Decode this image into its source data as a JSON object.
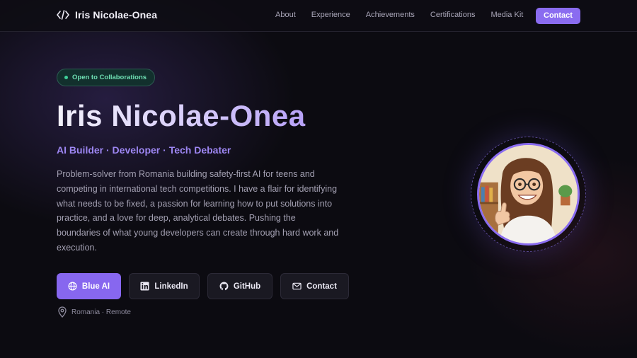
{
  "nav": {
    "brand_name": "Iris Nicolae-Onea",
    "brand_icon": "code-icon",
    "links": [
      "About",
      "Experience",
      "Achievements",
      "Certifications",
      "Media Kit"
    ],
    "contact_label": "Contact"
  },
  "hero": {
    "badge": "Open to Collaborations",
    "title": "Iris Nicolae-Onea",
    "subtitle": "AI Builder · Developer · Tech Debater",
    "description": "Problem-solver from Romania building safety-first AI for teens and competing in international tech competitions. I have a flair for identifying what needs to be fixed, a passion for learning how to put solutions into practice, and a love for deep, analytical debates. Pushing the boundaries of what young developers can create through hard work and execution.",
    "buttons": [
      {
        "label": "Blue AI",
        "icon": "globe-icon"
      },
      {
        "label": "LinkedIn",
        "icon": "linkedin-icon"
      },
      {
        "label": "GitHub",
        "icon": "github-icon"
      },
      {
        "label": "Contact",
        "icon": "mail-icon"
      }
    ],
    "location": "Romania · Remote"
  },
  "colors": {
    "accent": "#8a6cf0",
    "background": "#0c0b11",
    "badge_green": "#3fd09a"
  }
}
